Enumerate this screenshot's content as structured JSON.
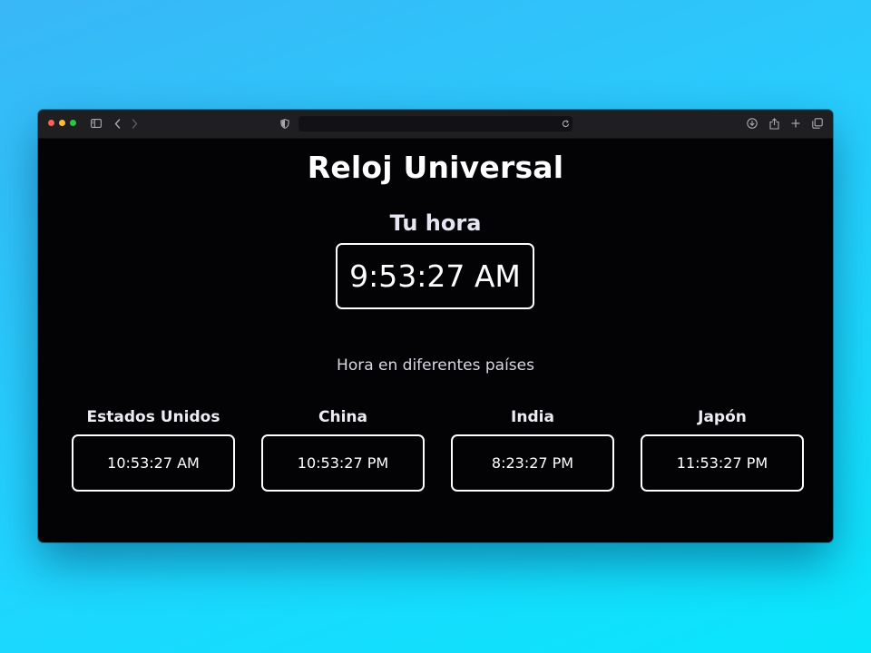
{
  "browser": {
    "icons": {
      "sidebar": "sidebar-icon",
      "back": "chevron-left-icon",
      "forward": "chevron-right-icon",
      "privacy": "shield-icon",
      "reload": "reload-icon",
      "download": "download-icon",
      "share": "share-icon",
      "new_tab": "plus-icon",
      "tabs": "tabs-overview-icon"
    },
    "url": ""
  },
  "page": {
    "title": "Reloj Universal",
    "your_time_label": "Tu hora",
    "your_time": "9:53:27 AM",
    "subtitle": "Hora en diferentes países"
  },
  "countries": [
    {
      "name": "Estados Unidos",
      "time": "10:53:27 AM"
    },
    {
      "name": "China",
      "time": "10:53:27 PM"
    },
    {
      "name": "India",
      "time": "8:23:27 PM"
    },
    {
      "name": "Japón",
      "time": "11:53:27 PM"
    }
  ],
  "colors": {
    "background_gradient_start": "#39b7f6",
    "background_gradient_end": "#08e6fb",
    "page_background": "#030305",
    "text": "#ffffff",
    "border": "#ffffff"
  }
}
